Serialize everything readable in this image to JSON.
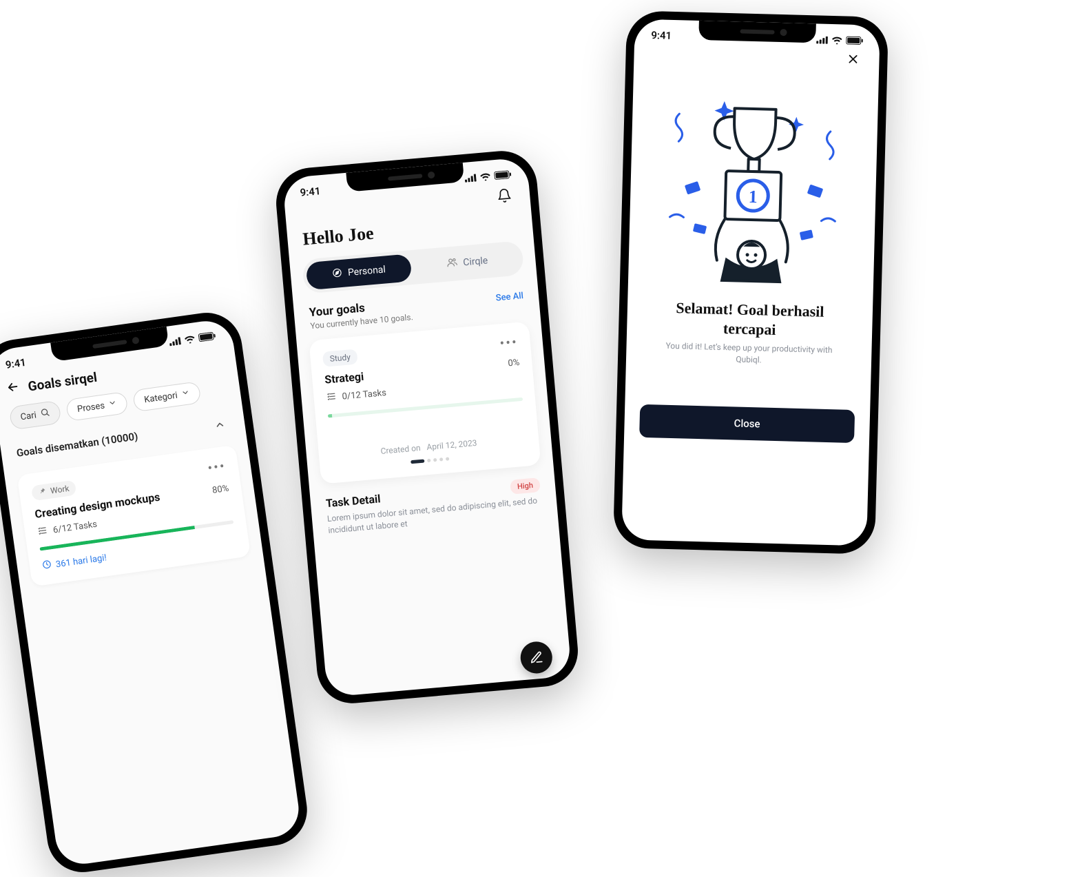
{
  "status": {
    "time": "9:41"
  },
  "phone1": {
    "title": "Goals sirqel",
    "chips": {
      "search": "Cari",
      "process": "Proses",
      "category": "Kategori"
    },
    "pinned_section": "Goals disematkan (10000)",
    "card": {
      "tag": "Work",
      "title": "Creating design mockups",
      "percent": "80%",
      "tasks": "6/12 Tasks",
      "days_left": "361 hari lagi!"
    }
  },
  "phone2": {
    "hello": "Hello Joe",
    "tabs": {
      "personal": "Personal",
      "cirqle": "Cirqle"
    },
    "goals": {
      "heading": "Your goals",
      "sub": "You currently have 10 goals.",
      "see_all": "See All"
    },
    "goal_card": {
      "tag": "Study",
      "title": "Strategi",
      "percent": "0%",
      "tasks": "0/12 Tasks",
      "created_label": "Created on",
      "created_date": "April 12, 2023"
    },
    "task": {
      "heading": "Task Detail",
      "priority": "High",
      "desc": "Lorem ipsum dolor sit amet, sed do adipiscing elit, sed do incididunt ut labore et"
    }
  },
  "phone3": {
    "title": "Selamat! Goal berhasil tercapai",
    "sub": "You did it! Let’s keep up your productivity with Qubiql.",
    "close": "Close"
  }
}
